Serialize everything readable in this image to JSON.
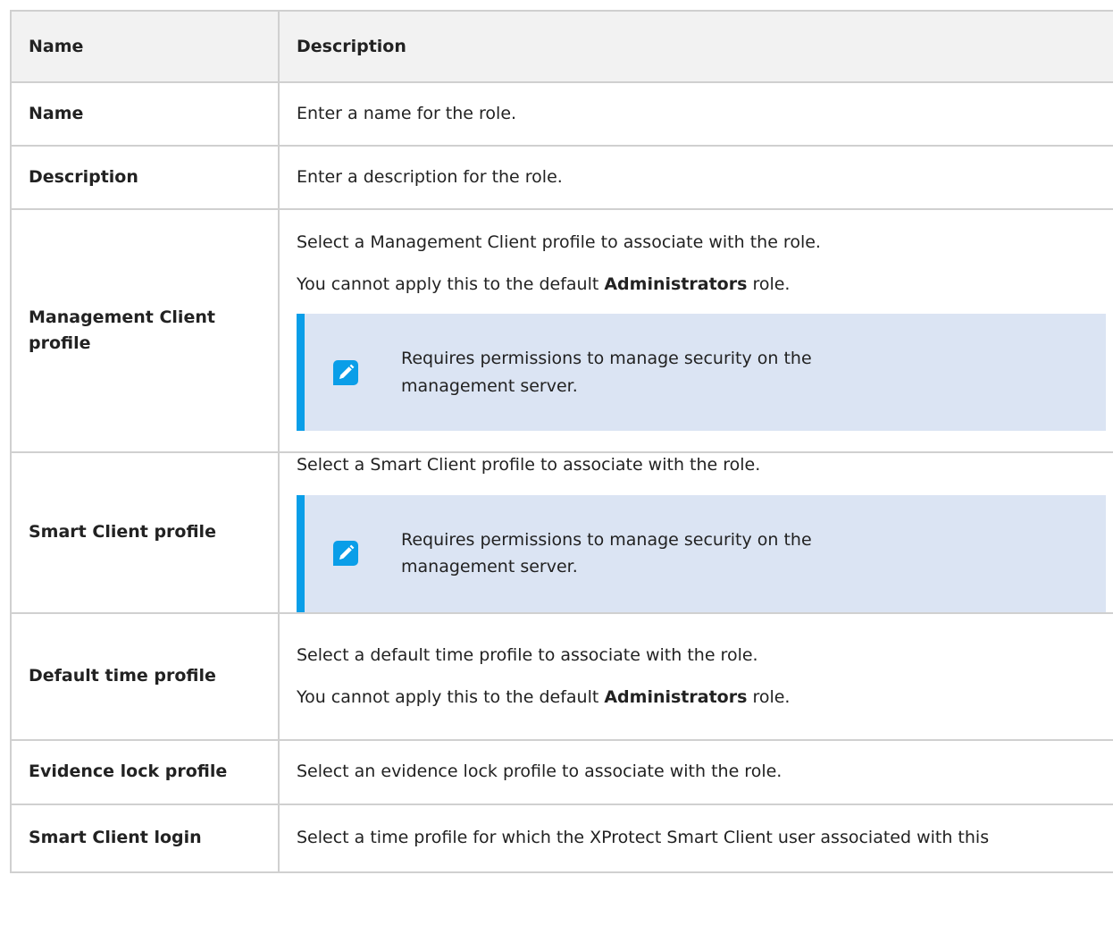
{
  "table": {
    "headers": {
      "name": "Name",
      "description": "Description"
    },
    "rows": {
      "name": {
        "label": "Name",
        "text": "Enter a name for the role."
      },
      "description": {
        "label": "Description",
        "text": "Enter a description for the role."
      },
      "management_client_profile": {
        "label": "Management Client profile",
        "text1": "Select a Management Client profile to associate with the role.",
        "text2_prefix": "You cannot apply this to the default ",
        "text2_bold": "Administrators",
        "text2_suffix": " role.",
        "note": "Requires permissions to manage security on the management server."
      },
      "smart_client_profile": {
        "label": "Smart Client profile",
        "text1": "Select a Smart Client profile to associate with the role.",
        "note": "Requires permissions to manage security on the management server."
      },
      "default_time_profile": {
        "label": "Default time profile",
        "text1": "Select a default time profile to associate with the role.",
        "text2_prefix": "You cannot apply this to the default ",
        "text2_bold": "Administrators",
        "text2_suffix": " role."
      },
      "evidence_lock_profile": {
        "label": "Evidence lock profile",
        "text": "Select an evidence lock profile to associate with the role."
      },
      "smart_client_login": {
        "label": "Smart Client login",
        "text": "Select a time profile for which the XProtect Smart Client user associated with this"
      }
    }
  },
  "note_icon": "pencil-icon",
  "colors": {
    "note_background": "#dbe4f3",
    "note_accent": "#0a9ee8",
    "header_background": "#f2f2f2",
    "border": "#d0d0d0"
  }
}
